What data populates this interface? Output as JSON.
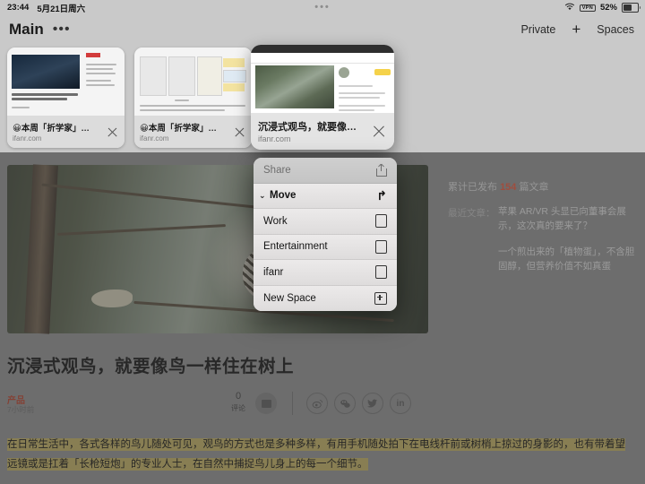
{
  "status_bar": {
    "time": "23:44",
    "date": "5月21日周六",
    "multitask_dots": "•••",
    "wifi_icon": "wifi-icon",
    "vpn_badge": "VPN",
    "battery_percent": "52%"
  },
  "overview": {
    "space_title": "Main",
    "more_button": "•••",
    "private_label": "Private",
    "plus_label": "+",
    "spaces_label": "Spaces"
  },
  "tabs": [
    {
      "title": "😀本周「折学家」…",
      "host": "ifanr.com",
      "close": "×"
    },
    {
      "title": "😀本周「折学家」…",
      "host": "ifanr.com",
      "close": "×"
    }
  ],
  "active_tab": {
    "title": "沉浸式观鸟，就要像…",
    "host": "ifanr.com",
    "close": "×"
  },
  "context_menu": {
    "share": {
      "label": "Share",
      "icon": "share-icon"
    },
    "move": {
      "label": "Move",
      "chevron": "⌄",
      "icon": "move-arrow-icon"
    },
    "spaces": [
      {
        "label": "Work",
        "icon": "empty-box-icon"
      },
      {
        "label": "Entertainment",
        "icon": "empty-box-icon"
      },
      {
        "label": "ifanr",
        "icon": "empty-box-icon"
      }
    ],
    "new_space": {
      "label": "New Space",
      "icon": "box-plus-icon"
    }
  },
  "article": {
    "title": "沉浸式观鸟，就要像鸟一样住在树上",
    "category": "产品",
    "time": "7小时前",
    "comment_count": "0",
    "comment_label": "评论",
    "share_icons": [
      "weibo-icon",
      "wechat-icon",
      "twitter-icon",
      "linkedin-icon"
    ],
    "body": "在日常生活中，各式各样的鸟儿随处可见，观鸟的方式也是多种多样，有用手机随处拍下在电线杆前或树梢上掠过的身影的，也有带着望远镜或是扛着「长枪短炮」的专业人士，在自然中捕捉鸟儿身上的每一个细节。"
  },
  "sidebar": {
    "stats_prefix": "累计已发布",
    "stats_number": "154",
    "stats_suffix": "篇文章",
    "recent_label": "最近文章：",
    "recent_items": [
      "苹果 AR/VR 头显已向董事会展示，这次真的要来了？",
      "一个煎出来的「植物蛋」，不含胆固醇，但营养价值不如真蛋"
    ]
  },
  "colors": {
    "accent_red": "#e0543a",
    "category_red": "#b0412c",
    "chrome_gray": "#c9c9c9",
    "highlight": "#b9a85e"
  }
}
